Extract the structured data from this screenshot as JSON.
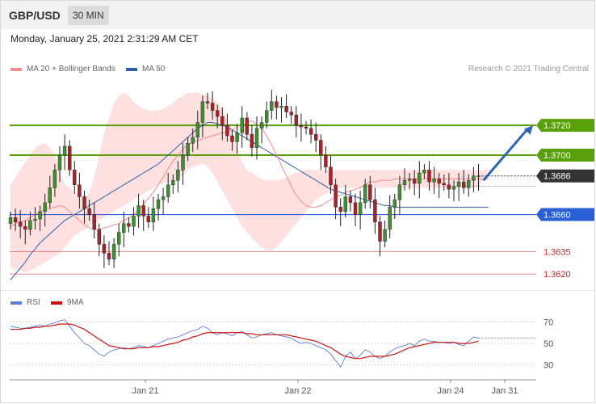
{
  "header": {
    "symbol": "GBP/USD",
    "timeframe": "30 MIN",
    "datetime": "Monday, January 25, 2021 2:31:29 AM CET"
  },
  "legend": {
    "ma20_label": "MA 20 + Bollinger Bands",
    "ma20_color": "#f28b8b",
    "ma50_label": "MA 50",
    "ma50_color": "#2f5fa7",
    "credit": "Research © 2021 Trading Central"
  },
  "rsi_legend": {
    "rsi_label": "RSI",
    "rsi_color": "#5b7fd6",
    "ma_label": "9MA",
    "ma_color": "#cc1111"
  },
  "chart_data": [
    {
      "type": "candlestick",
      "title": "GBP/USD",
      "ylim": [
        1.3613,
        1.375
      ],
      "current_price": 1.3686,
      "x_ticks": [
        "Jan 21",
        "Jan 22",
        "Jan 24",
        "Jan 31"
      ],
      "levels": [
        {
          "value": "1.3720",
          "kind": "resistance",
          "color": "#5aa00a"
        },
        {
          "value": "1.3700",
          "kind": "resistance",
          "color": "#5aa00a"
        },
        {
          "value": "1.3686",
          "kind": "current",
          "color": "#333333"
        },
        {
          "value": "1.3660",
          "kind": "pivot",
          "color": "#2a60d6"
        },
        {
          "value": "1.3635",
          "kind": "support",
          "color": "#cc2222"
        },
        {
          "value": "1.3620",
          "kind": "support",
          "color": "#cc2222"
        }
      ],
      "projection": {
        "from": 1.3683,
        "to": 1.372,
        "color": "#2b63b5"
      },
      "close": [
        1.3658,
        1.3655,
        1.3652,
        1.365,
        1.3656,
        1.3657,
        1.3662,
        1.3668,
        1.3678,
        1.369,
        1.37,
        1.3706,
        1.369,
        1.368,
        1.3672,
        1.3664,
        1.366,
        1.365,
        1.364,
        1.3634,
        1.363,
        1.364,
        1.3648,
        1.3654,
        1.3652,
        1.3659,
        1.3666,
        1.3659,
        1.3655,
        1.3664,
        1.367,
        1.3672,
        1.368,
        1.3683,
        1.369,
        1.37,
        1.3708,
        1.3712,
        1.3722,
        1.3736,
        1.3735,
        1.373,
        1.3726,
        1.372,
        1.3713,
        1.3709,
        1.3715,
        1.3725,
        1.3714,
        1.3705,
        1.3718,
        1.3722,
        1.373,
        1.3736,
        1.3732,
        1.3733,
        1.3729,
        1.3727,
        1.372,
        1.3719,
        1.3718,
        1.3714,
        1.371,
        1.37,
        1.3692,
        1.368,
        1.3665,
        1.3662,
        1.3672,
        1.3668,
        1.366,
        1.3668,
        1.368,
        1.367,
        1.3655,
        1.3642,
        1.365,
        1.3665,
        1.367,
        1.368,
        1.3683,
        1.3684,
        1.3681,
        1.3688,
        1.369,
        1.3682,
        1.3684,
        1.3681,
        1.368,
        1.3677,
        1.3679,
        1.3682,
        1.3678,
        1.3683,
        1.3686,
        1.3686
      ],
      "ma20": [
        1.3652,
        1.3654,
        1.3655,
        1.3656,
        1.3658,
        1.366,
        1.3662,
        1.3663,
        1.3664,
        1.3665,
        1.3666,
        1.3665,
        1.3662,
        1.3659,
        1.3656,
        1.3653,
        1.3651,
        1.365,
        1.365,
        1.3651,
        1.3652,
        1.3653,
        1.3654,
        1.3656,
        1.3658,
        1.366,
        1.3663,
        1.3667,
        1.3671,
        1.3675,
        1.368,
        1.3685,
        1.3691,
        1.3696,
        1.37,
        1.3704,
        1.3707,
        1.3709,
        1.371,
        1.3711,
        1.3712,
        1.3713,
        1.3714,
        1.3715,
        1.3716,
        1.3717,
        1.3719,
        1.3721,
        1.3722,
        1.3723,
        1.3721,
        1.3718,
        1.3713,
        1.3707,
        1.37,
        1.3693,
        1.3686,
        1.3679,
        1.3673,
        1.3669,
        1.3666,
        1.3665,
        1.3665,
        1.3666,
        1.3668,
        1.367,
        1.3672,
        1.3673,
        1.3675,
        1.3676,
        1.3677,
        1.3678,
        1.368,
        1.3682,
        1.3682,
        1.3683,
        1.3683,
        1.3683,
        1.3684,
        1.3684,
        1.3684,
        1.3684,
        1.3684,
        1.3684,
        1.3684,
        1.3684,
        1.3684,
        1.3684,
        1.3684,
        1.3684,
        1.3684,
        1.3684,
        1.3684,
        1.3684,
        1.3684,
        1.3684,
        1.3684,
        1.3684
      ],
      "ma50": [
        1.3616,
        1.362,
        1.3624,
        1.3628,
        1.3633,
        1.3637,
        1.3641,
        1.3644,
        1.3647,
        1.365,
        1.3653,
        1.3656,
        1.3658,
        1.366,
        1.3662,
        1.3664,
        1.3666,
        1.3668,
        1.367,
        1.3672,
        1.3674,
        1.3676,
        1.3678,
        1.368,
        1.3682,
        1.3684,
        1.3686,
        1.3688,
        1.369,
        1.3692,
        1.3694,
        1.3697,
        1.37,
        1.3703,
        1.3706,
        1.3709,
        1.3712,
        1.3715,
        1.3718,
        1.372,
        1.3722,
        1.3722,
        1.3721,
        1.372,
        1.3719,
        1.3717,
        1.3715,
        1.3713,
        1.3711,
        1.3709,
        1.3707,
        1.3705,
        1.3703,
        1.3701,
        1.3699,
        1.3697,
        1.3695,
        1.3693,
        1.3691,
        1.3689,
        1.3687,
        1.3685,
        1.3683,
        1.3681,
        1.3679,
        1.3677,
        1.3676,
        1.3675,
        1.3674,
        1.3673,
        1.3672,
        1.3671,
        1.367,
        1.3669,
        1.3668,
        1.3667,
        1.3666,
        1.3666,
        1.3665,
        1.3665,
        1.3665,
        1.3665,
        1.3665,
        1.3665,
        1.3665,
        1.3665,
        1.3665,
        1.3665,
        1.3665,
        1.3665,
        1.3665,
        1.3665,
        1.3665,
        1.3665,
        1.3665,
        1.3665,
        1.3665,
        1.3665
      ],
      "bb_upper": [
        1.368,
        1.3685,
        1.369,
        1.3695,
        1.37,
        1.3705,
        1.3707,
        1.3708,
        1.3705,
        1.37,
        1.369,
        1.368,
        1.3678,
        1.3675,
        1.3672,
        1.367,
        1.3675,
        1.3685,
        1.37,
        1.3715,
        1.3725,
        1.3735,
        1.374,
        1.3742,
        1.374,
        1.3736,
        1.3733,
        1.3731,
        1.373,
        1.373,
        1.373,
        1.3731,
        1.3733,
        1.3735,
        1.3738,
        1.374,
        1.3742,
        1.3742,
        1.3742,
        1.3741,
        1.374,
        1.3738,
        1.3735,
        1.3732,
        1.3725,
        1.3715,
        1.3705,
        1.3695,
        1.369,
        1.3688,
        1.3686,
        1.3684,
        1.3683,
        1.3683,
        1.3683,
        1.3684,
        1.3685,
        1.3687,
        1.3688,
        1.3689,
        1.369,
        1.369,
        1.369,
        1.369,
        1.369,
        1.369,
        1.369,
        1.369,
        1.369,
        1.369,
        1.369,
        1.369,
        1.369,
        1.369,
        1.369,
        1.369,
        1.369,
        1.369,
        1.369,
        1.369,
        1.369,
        1.369,
        1.369,
        1.369,
        1.369,
        1.369,
        1.369,
        1.369,
        1.369,
        1.369,
        1.369,
        1.369,
        1.369,
        1.369,
        1.369,
        1.369,
        1.369,
        1.369
      ],
      "bb_lower": [
        1.3624,
        1.3623,
        1.3622,
        1.3621,
        1.3622,
        1.3624,
        1.3626,
        1.3628,
        1.363,
        1.3632,
        1.3634,
        1.3638,
        1.3642,
        1.3646,
        1.3648,
        1.365,
        1.3652,
        1.3654,
        1.3656,
        1.3658,
        1.366,
        1.3662,
        1.3664,
        1.3666,
        1.3668,
        1.367,
        1.3672,
        1.3674,
        1.3676,
        1.3678,
        1.368,
        1.3681,
        1.3682,
        1.3683,
        1.3684,
        1.3686,
        1.369,
        1.3692,
        1.3693,
        1.3694,
        1.3692,
        1.3688,
        1.3682,
        1.3676,
        1.367,
        1.3664,
        1.3658,
        1.3652,
        1.3648,
        1.3644,
        1.3641,
        1.3638,
        1.3636,
        1.3636,
        1.3638,
        1.3642,
        1.3646,
        1.365,
        1.3654,
        1.3658,
        1.3662,
        1.3666,
        1.367,
        1.3672,
        1.3674,
        1.3676,
        1.3677,
        1.3678,
        1.3678,
        1.3678,
        1.3678,
        1.3678,
        1.3678,
        1.3678,
        1.3678,
        1.3678,
        1.3678,
        1.3678,
        1.3678,
        1.3678,
        1.3678,
        1.3678,
        1.3678,
        1.3678,
        1.3678,
        1.3678,
        1.3678,
        1.3678,
        1.3678,
        1.3678,
        1.3678,
        1.3678,
        1.3678,
        1.3678,
        1.3678,
        1.3678,
        1.3678,
        1.3678
      ]
    },
    {
      "type": "line",
      "ylim": [
        20,
        80
      ],
      "y_ticks": [
        "70",
        "50",
        "30"
      ],
      "series": [
        {
          "name": "RSI",
          "color": "#5b7fd6",
          "values": [
            66,
            65,
            64,
            64,
            65,
            66,
            67,
            66,
            68,
            69,
            71,
            72,
            66,
            60,
            55,
            50,
            48,
            44,
            40,
            38,
            42,
            44,
            45,
            46,
            45,
            46,
            48,
            47,
            46,
            48,
            50,
            52,
            54,
            55,
            56,
            58,
            60,
            62,
            63,
            66,
            64,
            60,
            58,
            60,
            59,
            57,
            60,
            61,
            58,
            55,
            56,
            58,
            59,
            60,
            58,
            57,
            56,
            55,
            52,
            50,
            51,
            50,
            48,
            46,
            44,
            40,
            34,
            28,
            38,
            42,
            36,
            39,
            44,
            42,
            38,
            36,
            38,
            42,
            45,
            47,
            48,
            50,
            48,
            52,
            54,
            52,
            52,
            51,
            51,
            50,
            51,
            49,
            48,
            52,
            56,
            55
          ]
        },
        {
          "name": "9MA",
          "color": "#cc1111",
          "values": [
            63,
            63,
            63,
            64,
            64,
            65,
            65,
            66,
            66,
            67,
            68,
            68,
            68,
            67,
            65,
            63,
            60,
            57,
            54,
            51,
            48,
            47,
            46,
            45,
            45,
            45,
            46,
            46,
            46,
            47,
            47,
            48,
            49,
            50,
            51,
            53,
            54,
            56,
            57,
            59,
            60,
            60,
            60,
            60,
            60,
            60,
            60,
            60,
            59,
            59,
            58,
            58,
            58,
            58,
            58,
            58,
            58,
            57,
            56,
            55,
            54,
            53,
            52,
            50,
            48,
            46,
            43,
            40,
            38,
            37,
            36,
            36,
            37,
            38,
            38,
            38,
            38,
            39,
            40,
            42,
            44,
            46,
            47,
            48,
            49,
            50,
            51,
            51,
            51,
            51,
            51,
            50,
            50,
            50,
            51,
            52
          ]
        }
      ]
    }
  ]
}
